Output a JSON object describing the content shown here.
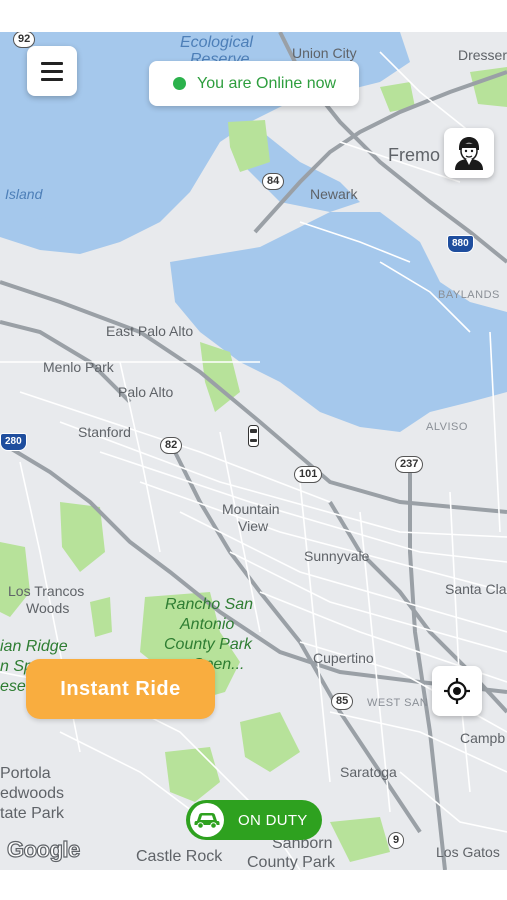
{
  "map": {
    "labels": {
      "ecological": "Ecological",
      "reserve": "Reserve",
      "union_city": "Union City",
      "dresser": "Dresser",
      "fremont": "Fremo",
      "island": "Island",
      "newark": "Newark",
      "baylands": "BAYLANDS",
      "east_palo_alto": "East Palo Alto",
      "menlo_park": "Menlo Park",
      "palo_alto": "Palo Alto",
      "stanford": "Stanford",
      "alviso": "ALVISO",
      "mountain_view_1": "Mountain",
      "mountain_view_2": "View",
      "sunnyvale": "Sunnyvale",
      "santa_clara": "Santa Cla",
      "los_trancos_1": "Los Trancos",
      "los_trancos_2": "Woods",
      "rancho_1": "Rancho San",
      "rancho_2": "Antonio",
      "rancho_3": "County Park",
      "rancho_4": "Open...",
      "ridge_1": "ian Ridge",
      "ridge_2": "n Sp",
      "ridge_3": "ese",
      "cupertino": "Cupertino",
      "west_san_jose": "WEST SAN JO",
      "campbell": "Campb",
      "portola_1": "Portola",
      "portola_2": "edwoods",
      "portola_3": "tate Park",
      "saratoga": "Saratoga",
      "castle_rock": "Castle Rock",
      "sanborn_1": "Sanborn",
      "sanborn_2": "County Park",
      "los_gatos": "Los Gatos"
    },
    "shields": {
      "r92": "92",
      "r84": "84",
      "i880": "880",
      "i280": "280",
      "r82": "82",
      "r101": "101",
      "r237": "237",
      "r85": "85",
      "r9": "9"
    },
    "attribution": "Google"
  },
  "header": {
    "status_text": "You are Online now"
  },
  "actions": {
    "instant_ride_label": "Instant Ride",
    "duty_label": "ON DUTY"
  },
  "colors": {
    "online_green": "#2bb24c",
    "duty_green": "#2ea11f",
    "instant_orange": "#f9ad3f",
    "water": "#a5c8ec",
    "park": "#b7e29a",
    "land": "#e8eaed"
  },
  "icons": {
    "menu": "hamburger-icon",
    "profile": "driver-avatar-icon",
    "locate": "crosshair-icon",
    "duty": "car-icon",
    "vehicle": "car-marker-icon"
  }
}
